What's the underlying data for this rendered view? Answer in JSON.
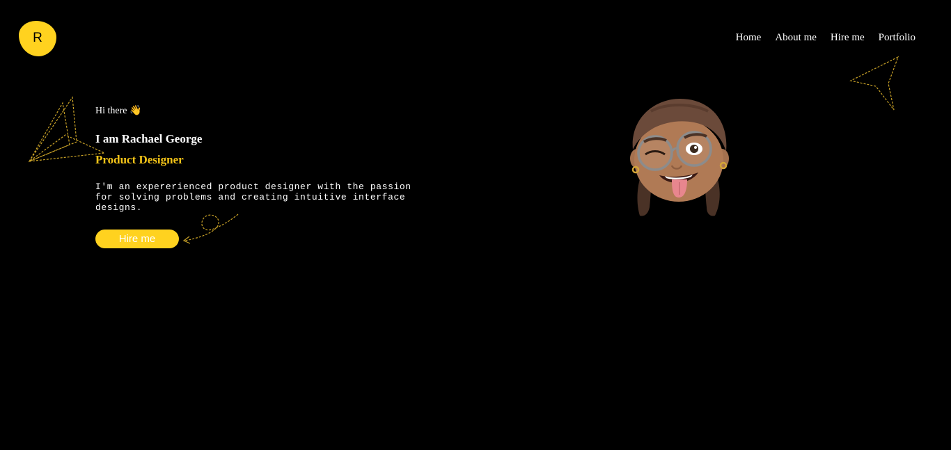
{
  "logo": {
    "letter": "R"
  },
  "nav": {
    "home": "Home",
    "about": "About me",
    "hire": "Hire me",
    "portfolio": "Portfolio"
  },
  "hero": {
    "greeting": "Hi there 👋",
    "name": "I am Rachael George",
    "role": "Product Designer",
    "description": "I'm an expererienced product designer with the passion for solving problems and creating intuitive interface designs.",
    "cta_label": "Hire me"
  },
  "colors": {
    "background": "#000000",
    "accent": "#FFD21F",
    "role_text": "#F5C518",
    "text": "#ffffff"
  },
  "icons": {
    "logo": "yellow-blob-logo",
    "decorations": [
      "dashed-star-decoration",
      "dashed-star-decoration",
      "dashed-loop-arrow-decoration"
    ],
    "avatar": "memoji-avatar"
  }
}
